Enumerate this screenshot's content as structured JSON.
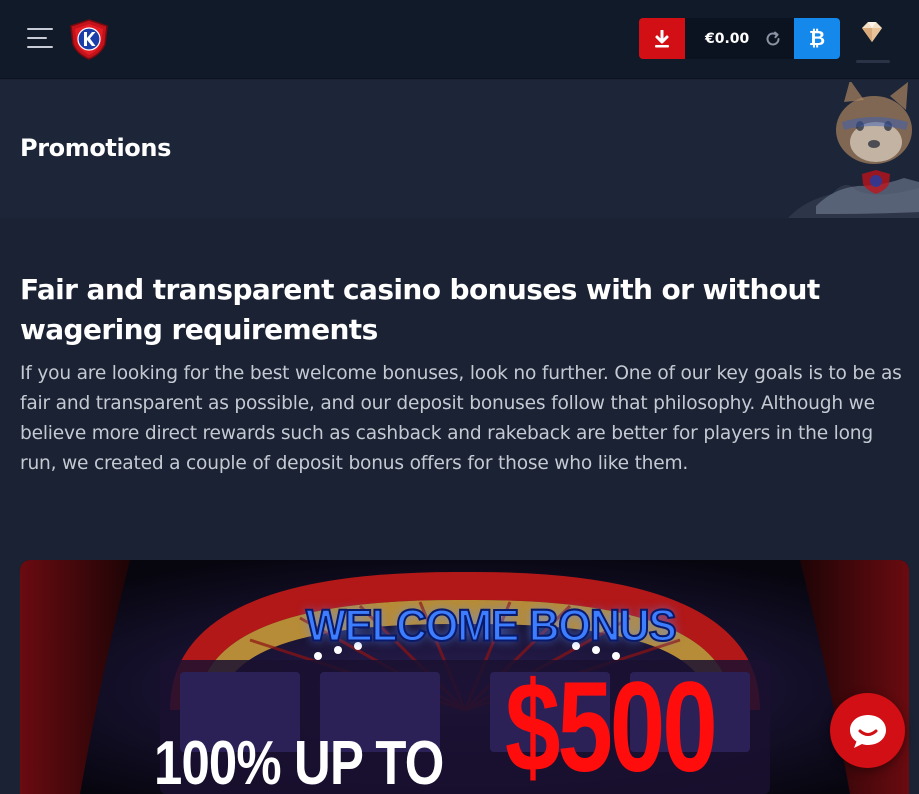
{
  "header": {
    "menu_icon": "hamburger-menu-icon",
    "logo_icon": "k-shield-logo-icon",
    "download_icon": "download-icon",
    "balance": "€0.00",
    "refresh_icon": "refresh-icon",
    "crypto_label": "₿",
    "vip_icon": "diamond-icon"
  },
  "promotions": {
    "title": "Promotions",
    "mascot": "shiba-mascot"
  },
  "content": {
    "heading": "Fair and transparent casino bonuses with or without wagering requirements",
    "paragraph": "If you are looking for the best welcome bonuses, look no further. One of our key goals is to be as fair and transparent as possible, and our deposit bonuses follow that philosophy. Although we believe more direct rewards such as cashback and rakeback are better for players in the long run, we created a couple of deposit bonus offers for those who like them."
  },
  "banner": {
    "welcome": "WELCOME BONUS",
    "offer": "100% UP TO",
    "amount": "$500"
  },
  "chat": {
    "icon": "chat-bubble-icon"
  },
  "colors": {
    "accent_red": "#d10f14",
    "crypto_blue": "#1588ec",
    "page_bg": "#1a2233",
    "topbar_bg": "#111a29"
  }
}
